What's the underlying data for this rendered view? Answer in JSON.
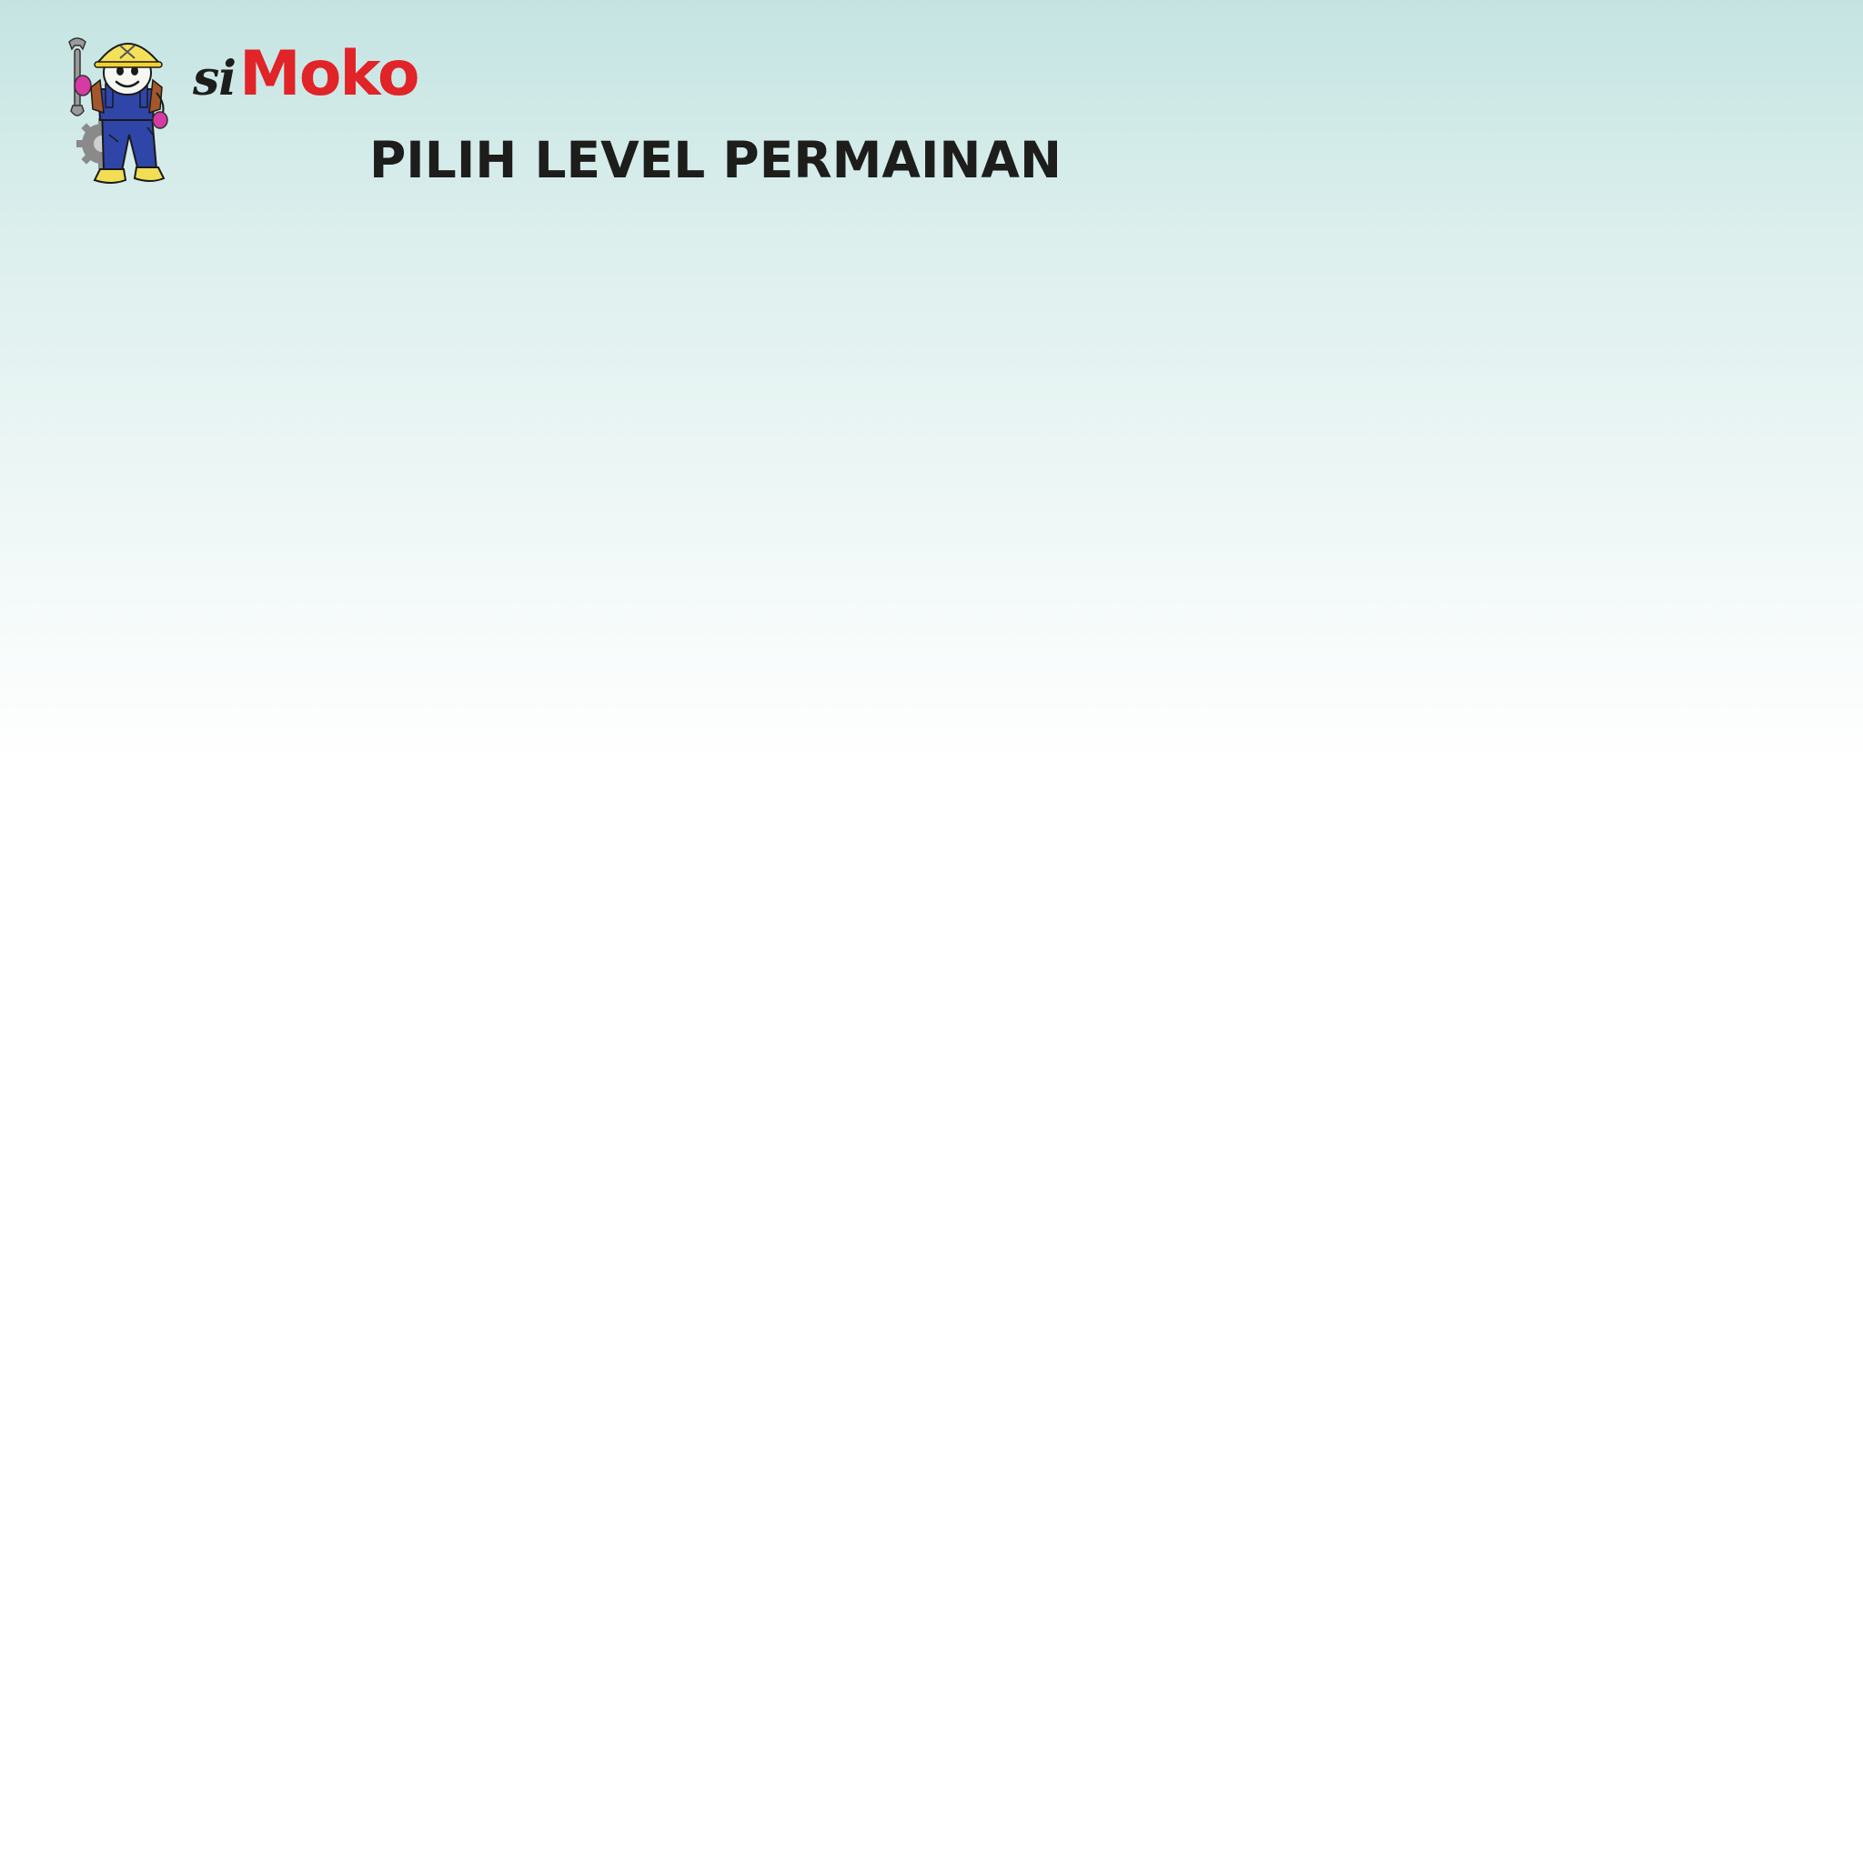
{
  "brand": {
    "prefix": "si",
    "name": "Moko",
    "mascot_icon": "mechanic-mascot-icon"
  },
  "screen": {
    "title": "PILIH LEVEL PERMAINAN"
  },
  "colors": {
    "background_top": "#c4e4e2",
    "background_bottom": "#ffffff",
    "brand_red": "#e02428",
    "text_dark": "#1d1d1b"
  }
}
